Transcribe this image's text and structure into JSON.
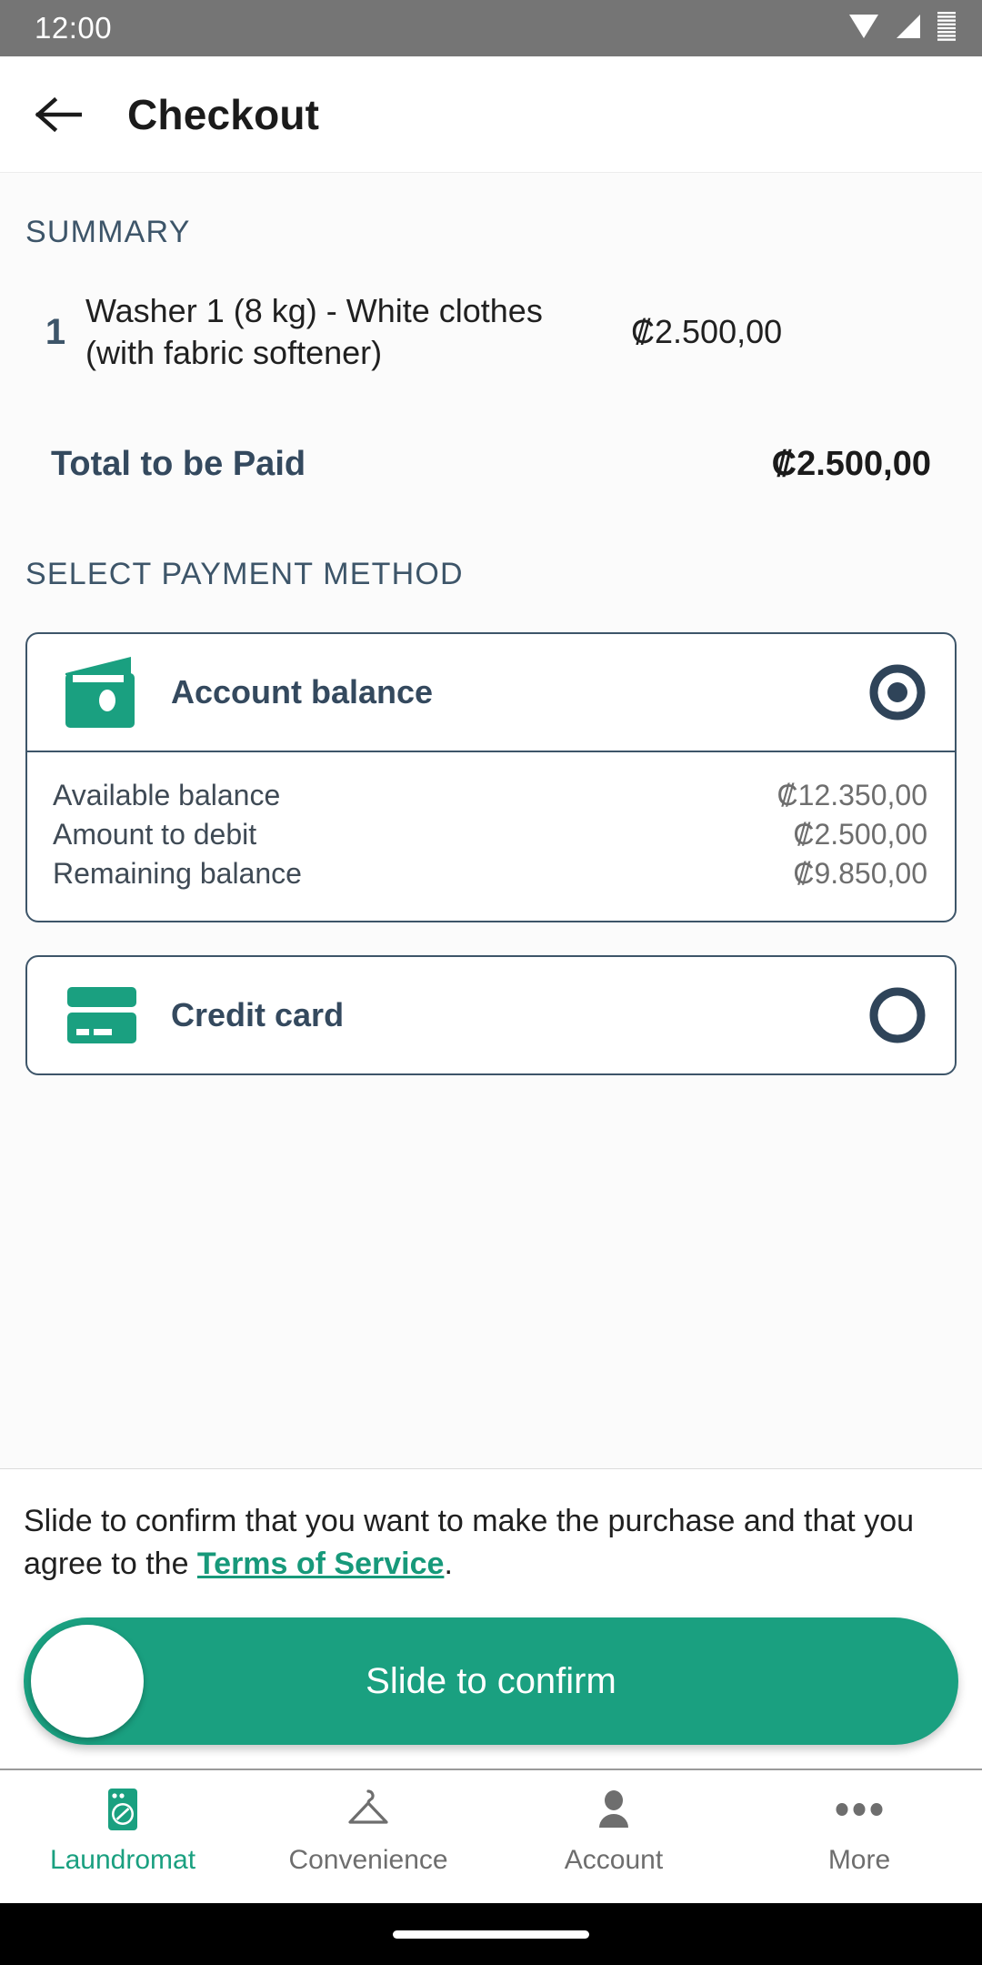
{
  "status_bar": {
    "time": "12:00",
    "icons": [
      "wifi-icon",
      "signal-icon",
      "battery-icon"
    ]
  },
  "app_bar": {
    "back_icon": "back-arrow-icon",
    "title": "Checkout"
  },
  "summary": {
    "section_label": "SUMMARY",
    "items": [
      {
        "quantity": "1",
        "name": "Washer 1 (8 kg) - White clothes (with fabric softener)",
        "price": "₡2.500,00"
      }
    ],
    "total_label": "Total to be Paid",
    "total_value": "₡2.500,00"
  },
  "payment": {
    "section_label": "SELECT PAYMENT METHOD",
    "methods": [
      {
        "id": "account-balance",
        "icon": "wallet-icon",
        "label": "Account balance",
        "selected": true,
        "details": [
          {
            "label": "Available balance",
            "value": "₡12.350,00"
          },
          {
            "label": "Amount to debit",
            "value": "₡2.500,00"
          },
          {
            "label": "Remaining balance",
            "value": "₡9.850,00"
          }
        ]
      },
      {
        "id": "credit-card",
        "icon": "credit-card-icon",
        "label": "Credit card",
        "selected": false,
        "details": []
      }
    ]
  },
  "confirm": {
    "text_before": "Slide to confirm that you want to make the purchase and that you agree to the ",
    "link_text": "Terms of Service",
    "text_after": ".",
    "slider_label": "Slide to confirm"
  },
  "bottom_nav": {
    "items": [
      {
        "label": "Laundromat",
        "icon": "washing-machine-icon",
        "active": true
      },
      {
        "label": "Convenience",
        "icon": "hanger-icon",
        "active": false
      },
      {
        "label": "Account",
        "icon": "person-icon",
        "active": false
      },
      {
        "label": "More",
        "icon": "more-dots-icon",
        "active": false
      }
    ]
  },
  "colors": {
    "accent_green": "#1aa080",
    "navy": "#34495e",
    "status_bar": "#757575",
    "muted_gray": "#6e6e6e"
  }
}
